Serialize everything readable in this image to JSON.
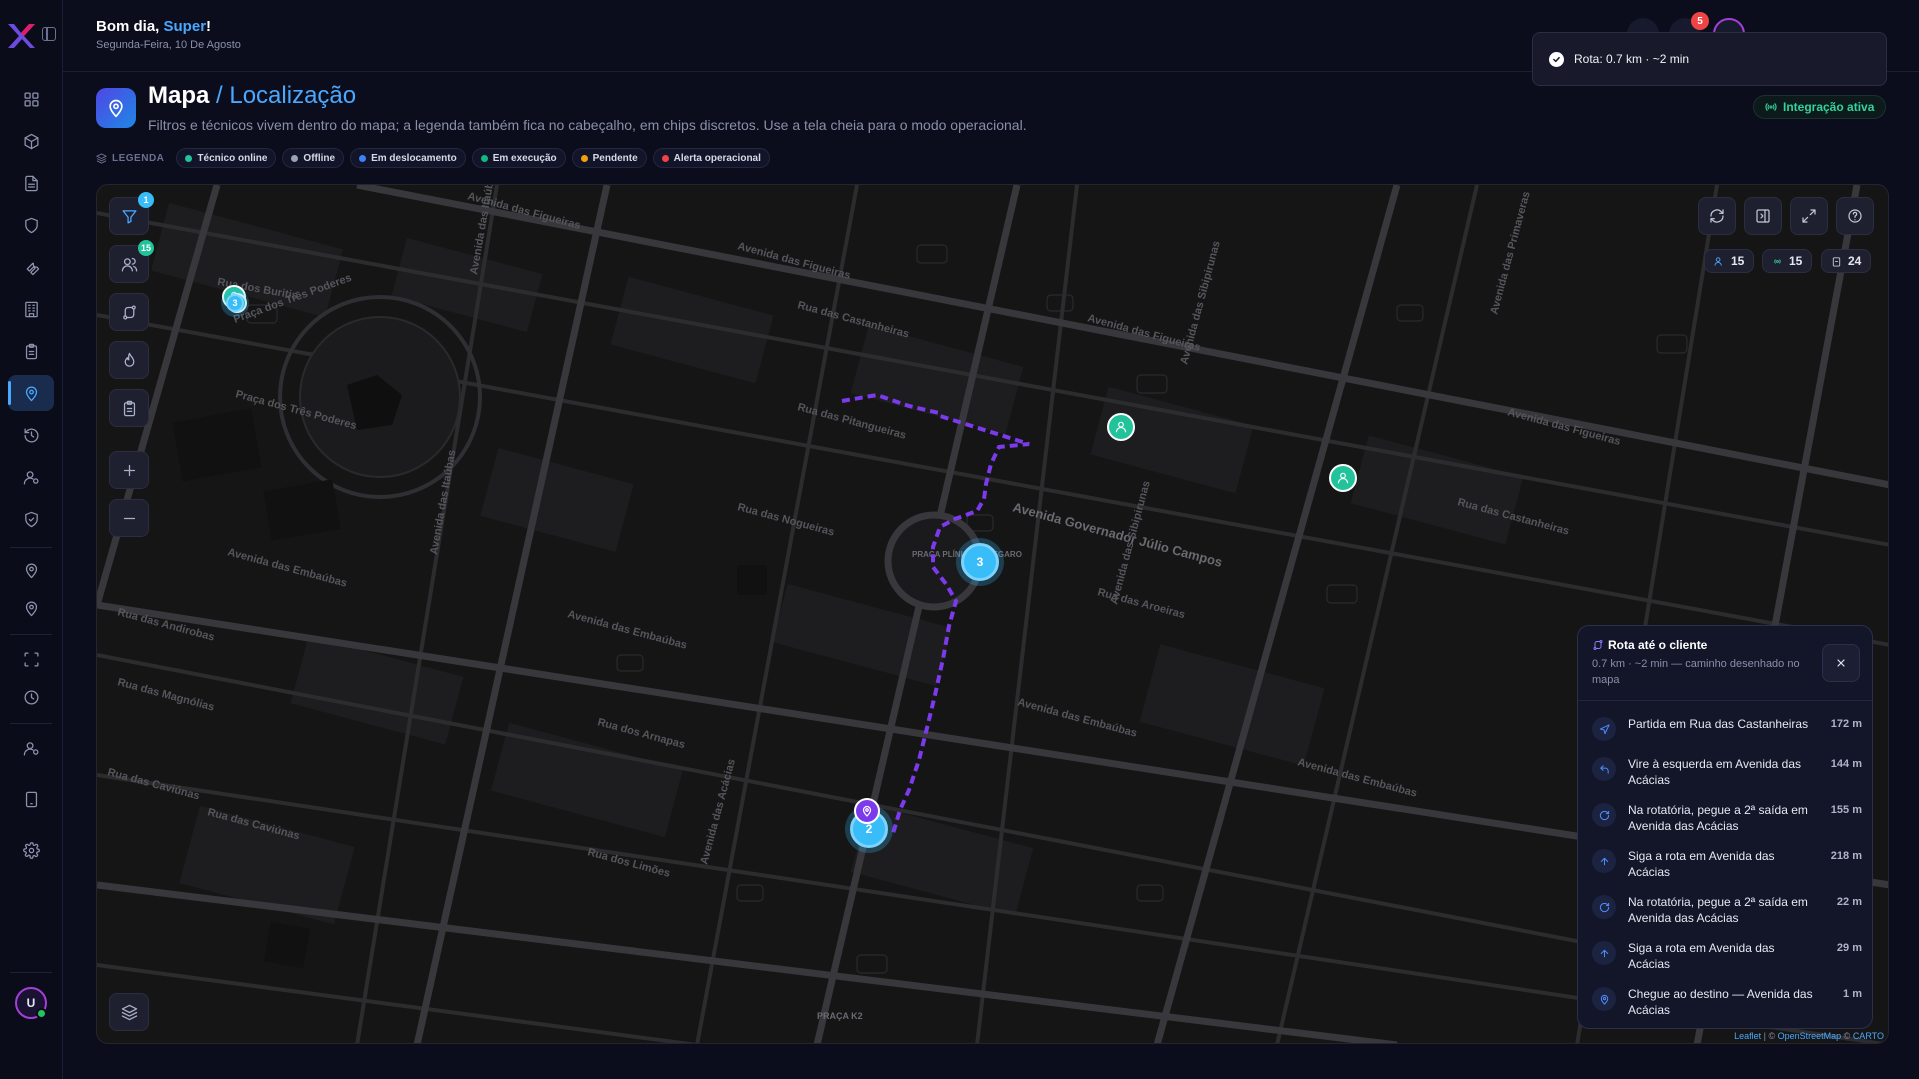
{
  "header": {
    "greeting_prefix": "Bom dia, ",
    "user_name": "Super",
    "greeting_suffix": "!",
    "date": "Segunda-Feira, 10 De Agosto",
    "notifications_count": "5"
  },
  "toast": {
    "message": "Rota: 0.7 km · ~2 min"
  },
  "page": {
    "title": "Mapa",
    "crumb": " / Localização",
    "subtitle": "Filtros e técnicos vivem dentro do mapa; a legenda também fica no cabeçalho, em chips discretos. Use a tela cheia para o modo operacional.",
    "integration_label": "Integração ativa"
  },
  "legend": {
    "title": "LEGENDA",
    "items": [
      {
        "label": "Técnico online",
        "color": "#22c39a"
      },
      {
        "label": "Offline",
        "color": "#9ca3af"
      },
      {
        "label": "Em deslocamento",
        "color": "#3b82f6"
      },
      {
        "label": "Em execução",
        "color": "#10b981"
      },
      {
        "label": "Pendente",
        "color": "#f59e0b"
      },
      {
        "label": "Alerta operacional",
        "color": "#ef4444"
      }
    ]
  },
  "map_tools": {
    "filter_count": "1",
    "technicians_count": "15"
  },
  "map_stats": {
    "technicians": "15",
    "online": "15",
    "orders": "24"
  },
  "map_markers": {
    "cluster_a": "3",
    "cluster_b": "2",
    "cluster_c": "3"
  },
  "street_labels": {
    "s1": "Avenida das Figueiras",
    "s2": "Avenida das Figueiras",
    "s3": "Avenida das Figueiras",
    "s4": "Praça dos Três Poderes",
    "s5": "Praça dos Três Poderes",
    "s6": "Avenida das Embaúbas",
    "s7": "Avenida das Embaúbas",
    "s8": "Avenida das Embaúbas",
    "s9": "Avenida das Embaúbas",
    "s10": "Avenida Governador Júlio Campos",
    "s11": "Rua das Castanheiras",
    "s12": "Rua das Pitangueiras",
    "s13": "Rua das Nogueiras",
    "s14": "Rua das Aroeiras",
    "s15": "Rua dos Arnapas",
    "s16": "Rua das Caviúnas",
    "s17": "Rua das Caviúnas",
    "s18": "Avenida das Acácias",
    "s19": "Avenida das Sibipirunas",
    "s20": "Avenida das Sibipirunas",
    "s21": "Avenida das Itaúbas",
    "s22": "Avenida das Itaúbas",
    "s23": "Rua das Magnólias",
    "s24": "PRAÇA PLÍNIO CALLEGARO",
    "s25": "Avenida das Primaveras",
    "s26": "Rua dos Buritis",
    "s27": "Rua das Andirobas",
    "s28": "Rua dos Limões",
    "s29": "Rua das Castanheiras",
    "s30": "PRAÇA K2"
  },
  "route_panel": {
    "title": "Rota até o cliente",
    "subtitle": "0.7 km · ~2 min — caminho desenhado no mapa",
    "steps": [
      {
        "text": "Partida em Rua das Castanheiras",
        "dist": "172 m",
        "icon": "navigation-icon"
      },
      {
        "text": "Vire à esquerda em Avenida das Acácias",
        "dist": "144 m",
        "icon": "turn-left-icon"
      },
      {
        "text": "Na rotatória, pegue a 2ª saída em Avenida das Acácias",
        "dist": "155 m",
        "icon": "roundabout-icon"
      },
      {
        "text": "Siga a rota em Avenida das Acácias",
        "dist": "218 m",
        "icon": "arrow-up-icon"
      },
      {
        "text": "Na rotatória, pegue a 2ª saída em Avenida das Acácias",
        "dist": "22 m",
        "icon": "roundabout-icon"
      },
      {
        "text": "Siga a rota em Avenida das Acácias",
        "dist": "29 m",
        "icon": "arrow-up-icon"
      },
      {
        "text": "Chegue ao destino — Avenida das Acácias",
        "dist": "1 m",
        "icon": "destination-icon"
      }
    ]
  },
  "attribution": {
    "leaflet": "Leaflet",
    "sep1": " | © ",
    "osm": "OpenStreetMap",
    "sep2": " © ",
    "carto": "CARTO"
  },
  "user": {
    "initial": "U"
  }
}
